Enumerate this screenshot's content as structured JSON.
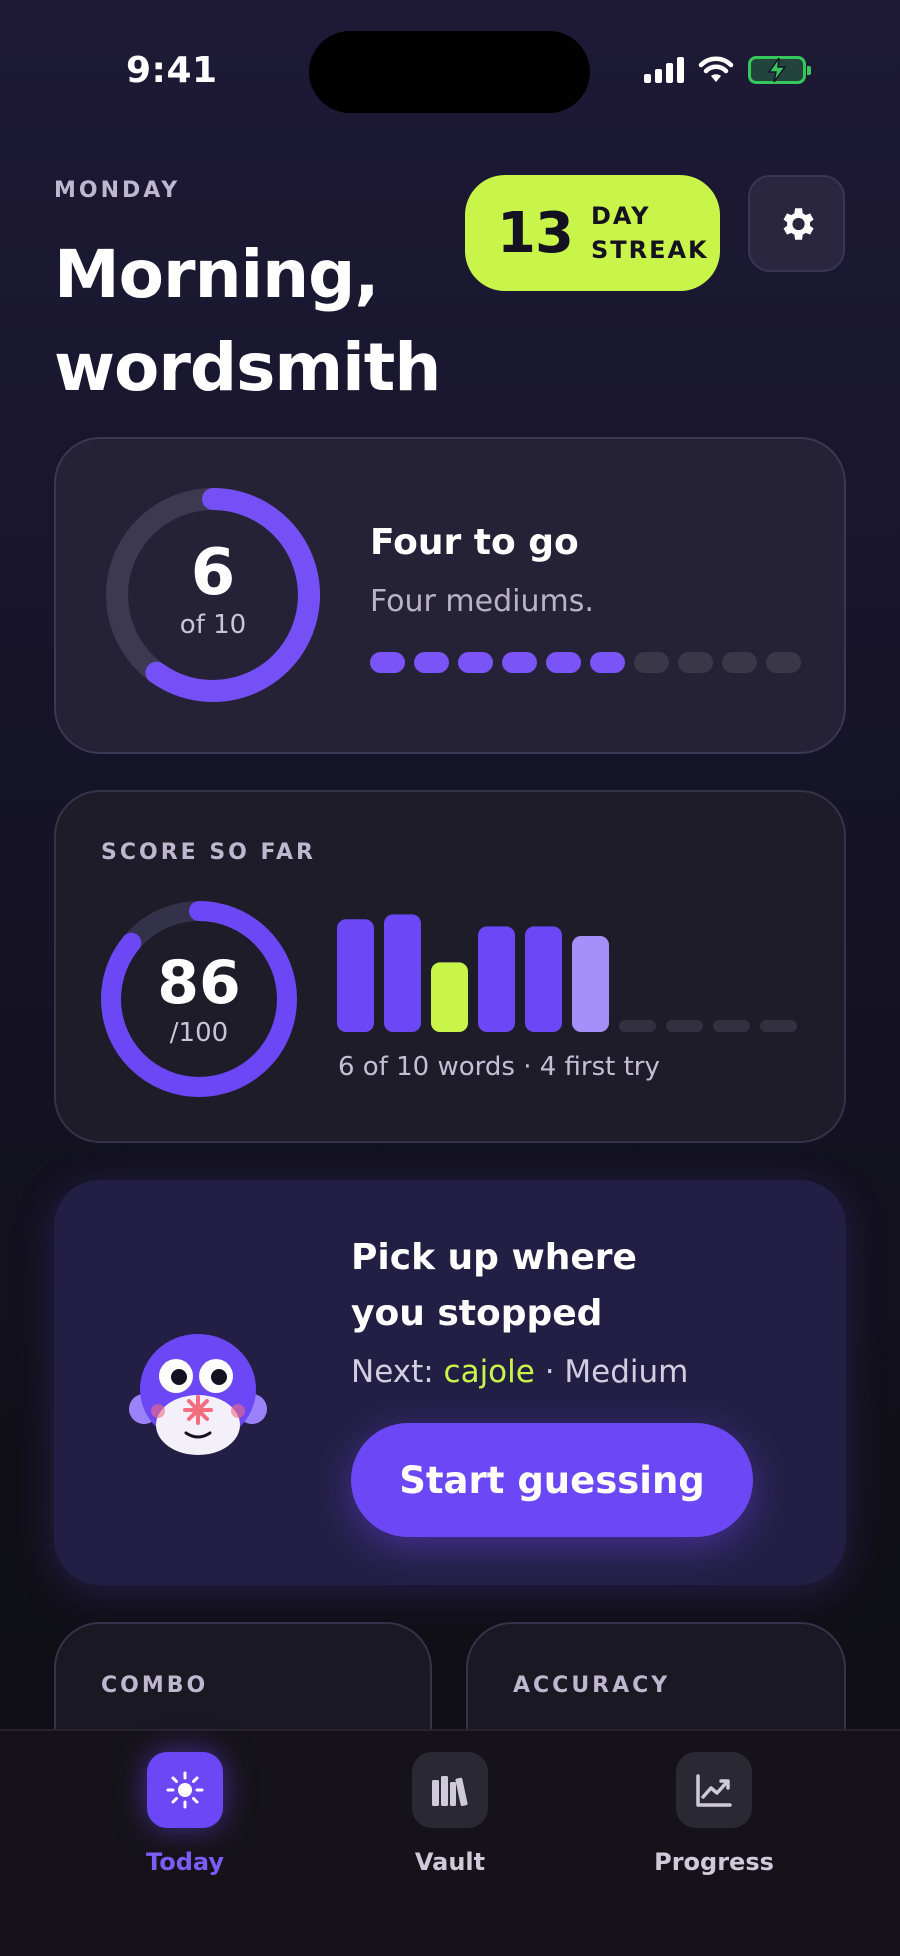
{
  "status_bar": {
    "time": "9:41"
  },
  "header": {
    "day": "MONDAY",
    "greeting_line1": "Morning,",
    "greeting_line2": "wordsmith",
    "streak_count": "13",
    "streak_line1": "DAY",
    "streak_line2": "STREAK"
  },
  "progress_card": {
    "count": "6",
    "of_label": "of 10",
    "completed": 6,
    "total": 10,
    "title": "Four to go",
    "subtitle": "Four mediums.",
    "colors": {
      "active": "#7a54f7",
      "inactive": "#3a3748"
    }
  },
  "score_card": {
    "label": "SCORE SO FAR",
    "score": "86",
    "score_max": "/100",
    "score_fraction": 0.86,
    "caption": "6 of 10 words · 4 first try",
    "word_results": [
      {
        "value": 0.94,
        "color": "#6c47f5"
      },
      {
        "value": 0.98,
        "color": "#6c47f5"
      },
      {
        "value": 0.58,
        "color": "#c9f44a"
      },
      {
        "value": 0.88,
        "color": "#6c47f5"
      },
      {
        "value": 0.88,
        "color": "#6c47f5"
      },
      {
        "value": 0.8,
        "color": "#a590fa"
      },
      {
        "value": 0,
        "color": "#33303f"
      },
      {
        "value": 0,
        "color": "#33303f"
      },
      {
        "value": 0,
        "color": "#33303f"
      },
      {
        "value": 0,
        "color": "#33303f"
      }
    ]
  },
  "resume_card": {
    "title_line1": "Pick up where",
    "title_line2": "you stopped",
    "next_prefix": "Next:",
    "next_word": "cajole",
    "next_separator": " · ",
    "next_level": "Medium",
    "button": "Start guessing"
  },
  "stats": {
    "combo_label": "COMBO",
    "accuracy_label": "ACCURACY"
  },
  "tabbar": {
    "today": "Today",
    "vault": "Vault",
    "progress": "Progress"
  },
  "colors": {
    "accent": "#6c47f5",
    "lime": "#c9f44a",
    "background": "#17142a"
  }
}
